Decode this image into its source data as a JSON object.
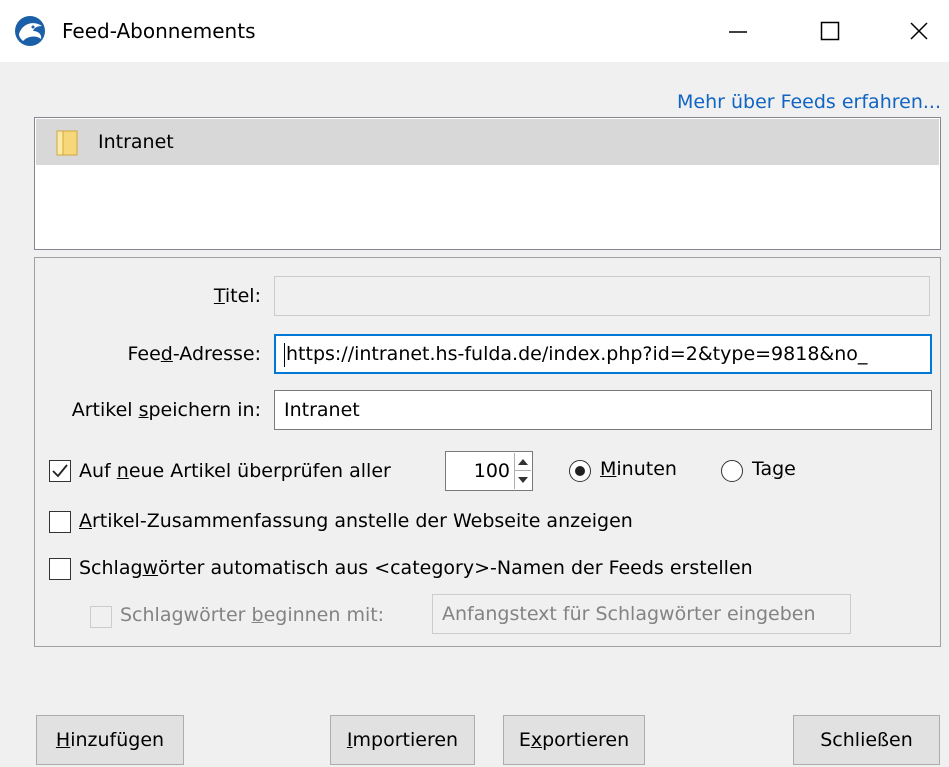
{
  "window": {
    "title": "Feed-Abonnements",
    "controls": [
      "minimize-icon",
      "maximize-icon",
      "close-icon"
    ]
  },
  "header": {
    "learn_more_link": "Mehr über Feeds erfahren..."
  },
  "tree": {
    "items": [
      {
        "label": "Intranet",
        "icon": "folder-icon",
        "selected": true
      }
    ]
  },
  "form": {
    "title_label_pre": "",
    "title_label_key": "T",
    "title_label_post": "itel:",
    "title_value": "",
    "feed_label_pre": "Fee",
    "feed_label_key": "d",
    "feed_label_post": "-Adresse:",
    "feed_value": "https://intranet.hs-fulda.de/index.php?id=2&type=9818&no_",
    "store_label_pre": "Artikel ",
    "store_label_key": "s",
    "store_label_post": "peichern in:",
    "store_value": "Intranet",
    "check_label_pre": "Auf ",
    "check_label_key": "n",
    "check_label_post": "eue Artikel überprüfen aller",
    "check_checked": true,
    "interval_value": "100",
    "unit_minutes_key": "M",
    "unit_minutes_post": "inuten",
    "unit_minutes_selected": true,
    "unit_days_pre": "Ta",
    "unit_days_key": "g",
    "unit_days_post": "e",
    "summary_label_key": "A",
    "summary_label_post": "rtikel-Zusammenfassung anstelle der Webseite anzeigen",
    "summary_checked": false,
    "tags_label_pre": "Schlag",
    "tags_label_key": "w",
    "tags_label_post": "örter automatisch aus <category>-Namen der Feeds erstellen",
    "tags_checked": false,
    "prefix_label_pre": "Schlagwörter ",
    "prefix_label_key": "b",
    "prefix_label_post": "eginnen mit:",
    "prefix_checked": false,
    "prefix_placeholder": "Anfangstext für Schlagwörter eingeben"
  },
  "buttons": {
    "add_key": "H",
    "add_post": "inzufügen",
    "import_key": "I",
    "import_post": "mportieren",
    "export_pre": "E",
    "export_key": "x",
    "export_post": "portieren",
    "close": "Schließen"
  },
  "colors": {
    "accent": "#0078d7",
    "link": "#0f64c4",
    "selection": "#d8d8d8",
    "panel": "#f0f0f0"
  }
}
